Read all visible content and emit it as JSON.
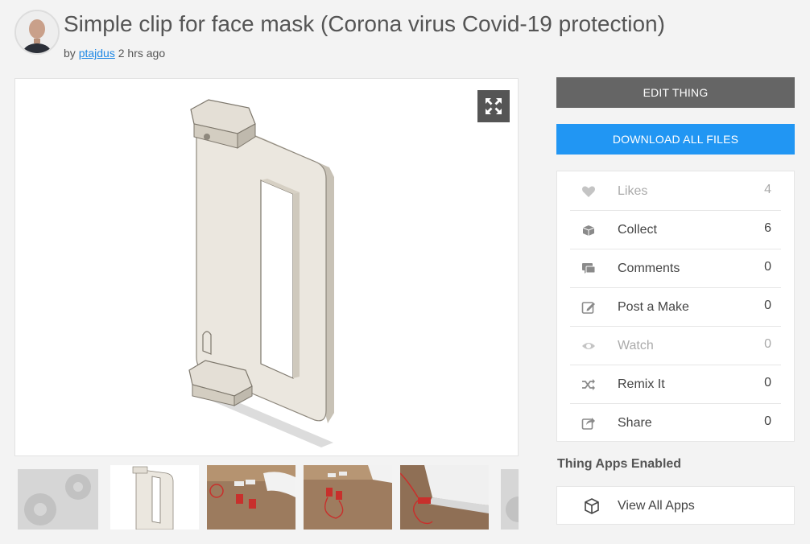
{
  "thing": {
    "title": "Simple clip for face mask (Corona virus Covid-19 protection)",
    "by_prefix": "by",
    "author": "ptajdus",
    "time_ago": "2 hrs ago"
  },
  "actions": {
    "edit_label": "EDIT THING",
    "download_label": "DOWNLOAD ALL FILES"
  },
  "stats": [
    {
      "label": "Likes",
      "count": "4",
      "icon": "heart-icon"
    },
    {
      "label": "Collect",
      "count": "6",
      "icon": "collect-icon"
    },
    {
      "label": "Comments",
      "count": "0",
      "icon": "comments-icon"
    },
    {
      "label": "Post a Make",
      "count": "0",
      "icon": "edit-pencil-icon"
    },
    {
      "label": "Watch",
      "count": "0",
      "icon": "eye-icon"
    },
    {
      "label": "Remix It",
      "count": "0",
      "icon": "shuffle-icon"
    },
    {
      "label": "Share",
      "count": "0",
      "icon": "share-icon"
    }
  ],
  "apps": {
    "heading": "Thing Apps Enabled",
    "view_all_label": "View All Apps"
  },
  "colors": {
    "edit_button": "#656565",
    "download_button": "#2196f3",
    "link": "#1e88e5",
    "page_background": "#f3f3f3"
  }
}
